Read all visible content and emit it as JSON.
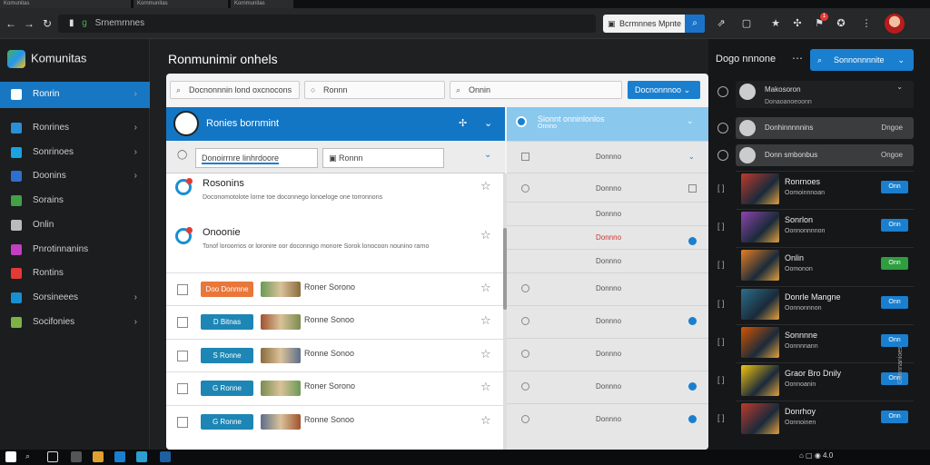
{
  "browser": {
    "tabs": [
      "Komunitas",
      "Kornmunitas",
      "Kornmunitas"
    ],
    "address": "Srnemrnnes",
    "address_prefix": "g",
    "search_placeholder": "Bcrmnnes Mpnte",
    "notification_count": "1"
  },
  "sidebar": {
    "brand": "Komunitas",
    "items": [
      {
        "label": "Ronrin",
        "icon": "home-icon",
        "color": "#1877c2",
        "active": true,
        "chevron": "›"
      },
      {
        "label": "Ronrines",
        "icon": "chart-icon",
        "color": "#2b8fd6",
        "active": false,
        "chevron": "›"
      },
      {
        "label": "Sonrinoes",
        "icon": "grid-icon",
        "color": "#1aa3e0",
        "active": false,
        "chevron": "›"
      },
      {
        "label": "Doonins",
        "icon": "folder-icon",
        "color": "#2e6fd1",
        "active": false,
        "chevron": "›"
      },
      {
        "label": "Sorains",
        "icon": "check-icon",
        "color": "#43a047",
        "active": false,
        "chevron": ""
      },
      {
        "label": "Onlin",
        "icon": "gear-icon",
        "color": "#bbbbbb",
        "active": false,
        "chevron": ""
      },
      {
        "label": "Pnrotinnanins",
        "icon": "puzzle-icon",
        "color": "#c040c0",
        "active": false,
        "chevron": ""
      },
      {
        "label": "Rontins",
        "icon": "flag-icon",
        "color": "#e53935",
        "active": false,
        "chevron": ""
      },
      {
        "label": "Sorsineees",
        "icon": "mail-icon",
        "color": "#1a8fd0",
        "active": false,
        "chevron": "›"
      },
      {
        "label": "Socifonies",
        "icon": "leaf-icon",
        "color": "#7cb342",
        "active": false,
        "chevron": "›"
      }
    ]
  },
  "main": {
    "title": "Ronmunimir onhels",
    "filters": {
      "f1": "Docnonnnin lond oxcnocons",
      "f2": "Ronnn",
      "f3": "Onnin",
      "button": "Docnonnnoo"
    },
    "colA": {
      "header": "Ronies bornmint",
      "sub1": "Donoirrnre linhrdoore",
      "sub2": "Ronnn",
      "notifs": [
        {
          "title": "Rosonins",
          "body": "Doconomotolote lorne toe doconnego lonoeloge one torronnons"
        },
        {
          "title": "Onoonie",
          "body": "Tonof loroorrios or loronire oor doconnigo monore Sorok lonocoon nounino rarno"
        }
      ],
      "rows": [
        {
          "tag": "Doo Donmne",
          "tag_color": "#e8773a",
          "name": "Roner Sorono",
          "checkbox": true
        },
        {
          "tag": "D Bitnas",
          "tag_color": "#1d86b5",
          "name": "Ronne Sonoo",
          "checkbox": true
        },
        {
          "tag": "S Ronne",
          "tag_color": "#1d86b5",
          "name": "Ronne Sonoo",
          "checkbox": true
        },
        {
          "tag": "G Ronne",
          "tag_color": "#1d86b5",
          "name": "Roner Sorono",
          "checkbox": true
        },
        {
          "tag": "G Ronne",
          "tag_color": "#1d86b5",
          "name": "Ronne Sonoo",
          "checkbox": true
        }
      ]
    },
    "colB": {
      "header": "Sionnt onninlonlos",
      "header_sub": "Onnno",
      "rows": [
        {
          "label": "Donnno",
          "radio": "sq",
          "end": "check"
        },
        {
          "label": "Donnno",
          "radio": "rad",
          "end": "sq"
        },
        {
          "label": "Donnno",
          "radio": "",
          "end": ""
        },
        {
          "label": "Donnno",
          "radio": "",
          "end": "dot",
          "red": true
        },
        {
          "label": "Donnno",
          "radio": "",
          "end": ""
        },
        {
          "label": "Donnno",
          "radio": "rad",
          "end": ""
        },
        {
          "label": "Donnno",
          "radio": "rad",
          "end": "dot"
        },
        {
          "label": "Donnno",
          "radio": "rad",
          "end": ""
        },
        {
          "label": "Donnno",
          "radio": "rad",
          "end": "dot"
        },
        {
          "label": "Donnno",
          "radio": "rad",
          "end": "dot"
        }
      ]
    }
  },
  "right": {
    "title": "Dogo nnnone",
    "more": "⋯",
    "button": "Sonnonnnnite",
    "selects": [
      {
        "label": "Makosoron",
        "sub": "Donaoanoeoonn",
        "dark": true
      },
      {
        "label": "Donhinnnnnins",
        "value": "Dngoe"
      },
      {
        "label": "Donn smbonbus",
        "value": "Ongoe"
      }
    ],
    "games": [
      {
        "title": "Ronrnoes",
        "sub": "Oomoinnnoan",
        "pill": "Onn",
        "pill_color": "#1a7fcf",
        "cover": "#c0392b"
      },
      {
        "title": "Sonrlon",
        "sub": "Oonnonnnnon",
        "pill": "Onn",
        "pill_color": "#1a7fcf",
        "cover": "#8e44ad"
      },
      {
        "title": "Onlin",
        "sub": "Oomonon",
        "pill": "Onn",
        "pill_color": "#2e9e3f",
        "cover": "#e67e22"
      },
      {
        "title": "Donrle Mangne",
        "sub": "Oonnonnnon",
        "pill": "Onn",
        "pill_color": "#1a7fcf",
        "cover": "#2c6e8a"
      },
      {
        "title": "Sonnnne",
        "sub": "Oonnnnann",
        "pill": "Onn",
        "pill_color": "#1a7fcf",
        "cover": "#d35400"
      },
      {
        "title": "Graor Bro Dnily",
        "sub": "Oonnoanin",
        "pill": "Onn",
        "pill_color": "#1a7fcf",
        "cover": "#f1c40f"
      },
      {
        "title": "Donrhoy",
        "sub": "Oonnoinen",
        "pill": "Onn",
        "pill_color": "#1a7fcf",
        "cover": "#c0392b"
      }
    ],
    "side_label": "Gonnnanioes"
  },
  "taskbar": {
    "clock": "4.0"
  }
}
